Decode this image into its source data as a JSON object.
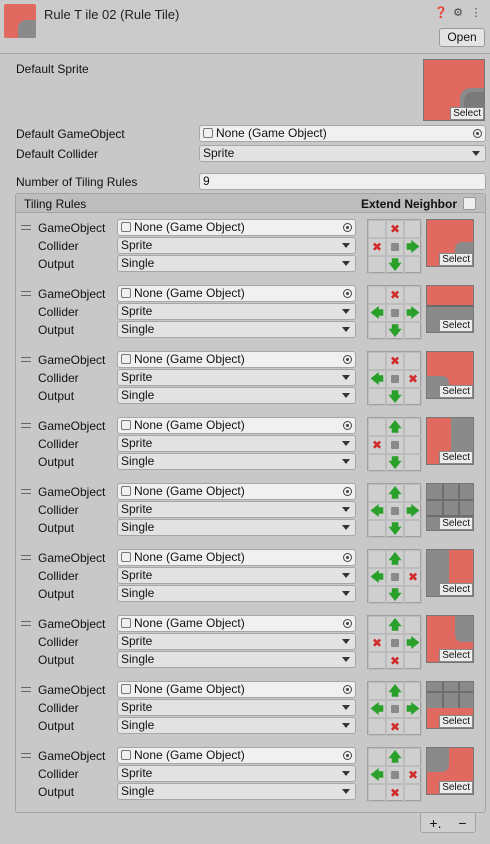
{
  "header": {
    "title": "Rule T ile 02 (Rule Tile)",
    "open_label": "Open",
    "icons": [
      "help-icon",
      "settings-icon",
      "menu-icon"
    ]
  },
  "default_sprite_label": "Default Sprite",
  "select_label": "Select",
  "default_gameobject": {
    "label": "Default GameObject",
    "value": "None (Game Object)"
  },
  "default_collider": {
    "label": "Default Collider",
    "value": "Sprite"
  },
  "num_rules": {
    "label": "Number of Tiling Rules",
    "value": "9"
  },
  "tiling_rules": {
    "title": "Tiling Rules",
    "extend_label": "Extend Neighbor",
    "gameobject_label": "GameObject",
    "collider_label": "Collider",
    "output_label": "Output",
    "gameobject_value": "None (Game Object)",
    "collider_value": "Sprite",
    "output_value": "Single",
    "rules": [
      {
        "grid": [
          "",
          "x",
          "",
          "x",
          "c",
          ">",
          "",
          "v",
          ""
        ],
        "thumb": "corner-tl"
      },
      {
        "grid": [
          "",
          "x",
          "",
          "<",
          "c",
          ">",
          "",
          "v",
          ""
        ],
        "thumb": "edge-top"
      },
      {
        "grid": [
          "",
          "x",
          "",
          "<",
          "c",
          "x",
          "",
          "v",
          ""
        ],
        "thumb": "corner-tr"
      },
      {
        "grid": [
          "",
          "^",
          "",
          "x",
          "c",
          "",
          "",
          "v",
          ""
        ],
        "thumb": "edge-left"
      },
      {
        "grid": [
          "",
          "^",
          "",
          "<",
          "c",
          ">",
          "",
          "v",
          ""
        ],
        "thumb": "center"
      },
      {
        "grid": [
          "",
          "^",
          "",
          "<",
          "c",
          "x",
          "",
          "v",
          ""
        ],
        "thumb": "edge-right"
      },
      {
        "grid": [
          "",
          "^",
          "",
          "x",
          "c",
          ">",
          "",
          "x",
          ""
        ],
        "thumb": "corner-bl"
      },
      {
        "grid": [
          "",
          "^",
          "",
          "<",
          "c",
          ">",
          "",
          "x",
          ""
        ],
        "thumb": "edge-bottom"
      },
      {
        "grid": [
          "",
          "^",
          "",
          "<",
          "c",
          "x",
          "",
          "x",
          ""
        ],
        "thumb": "corner-br"
      }
    ]
  },
  "footer": {
    "add_label": "+.",
    "remove_label": "−"
  },
  "colors": {
    "red_tile": "#e06a60",
    "stone": "#8a8a8a",
    "green_arrow": "#28a02a",
    "red_x": "#d22b2b"
  }
}
